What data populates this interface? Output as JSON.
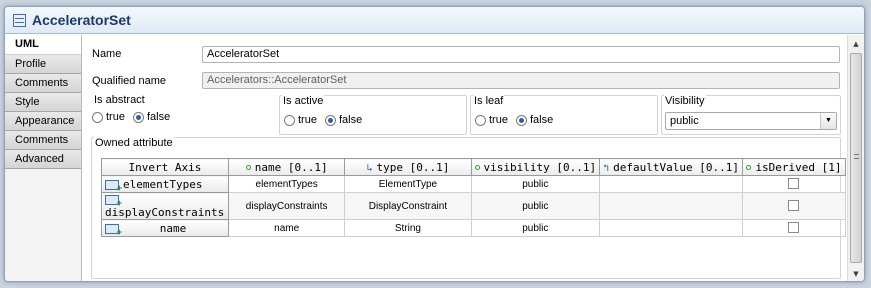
{
  "window": {
    "title": "AcceleratorSet"
  },
  "tabs": [
    "UML",
    "Profile",
    "Comments",
    "Style",
    "Appearance",
    "Comments",
    "Advanced"
  ],
  "form": {
    "name_label": "Name",
    "name_value": "AcceleratorSet",
    "qualified_label": "Qualified name",
    "qualified_value": "Accelerators::AcceleratorSet",
    "is_abstract": {
      "label": "Is abstract",
      "true_label": "true",
      "false_label": "false",
      "selected": "false"
    },
    "is_active": {
      "label": "Is active",
      "true_label": "true",
      "false_label": "false",
      "selected": "false"
    },
    "is_leaf": {
      "label": "Is leaf",
      "true_label": "true",
      "false_label": "false",
      "selected": "false"
    },
    "visibility": {
      "label": "Visibility",
      "value": "public"
    },
    "owned_attribute_label": "Owned attribute"
  },
  "table": {
    "corner": "Invert Axis",
    "columns": [
      "name [0..1]",
      "type [0..1]",
      "visibility [0..1]",
      "defaultValue [0..1]",
      "isDerived [1]"
    ],
    "rows": [
      {
        "header": "elementTypes",
        "name": "elementTypes",
        "type": "ElementType",
        "visibility": "public",
        "defaultValue": "",
        "isDerived": false
      },
      {
        "header": "displayConstraints",
        "name": "displayConstraints",
        "type": "DisplayConstraint",
        "visibility": "public",
        "defaultValue": "",
        "isDerived": false
      },
      {
        "header": "name",
        "name": "name",
        "type": "String",
        "visibility": "public",
        "defaultValue": "",
        "isDerived": false
      }
    ]
  },
  "colors": {
    "accent": "#2a5fa8",
    "title_text": "#1a3a6a",
    "tab_bg": "#d4d4d4"
  }
}
